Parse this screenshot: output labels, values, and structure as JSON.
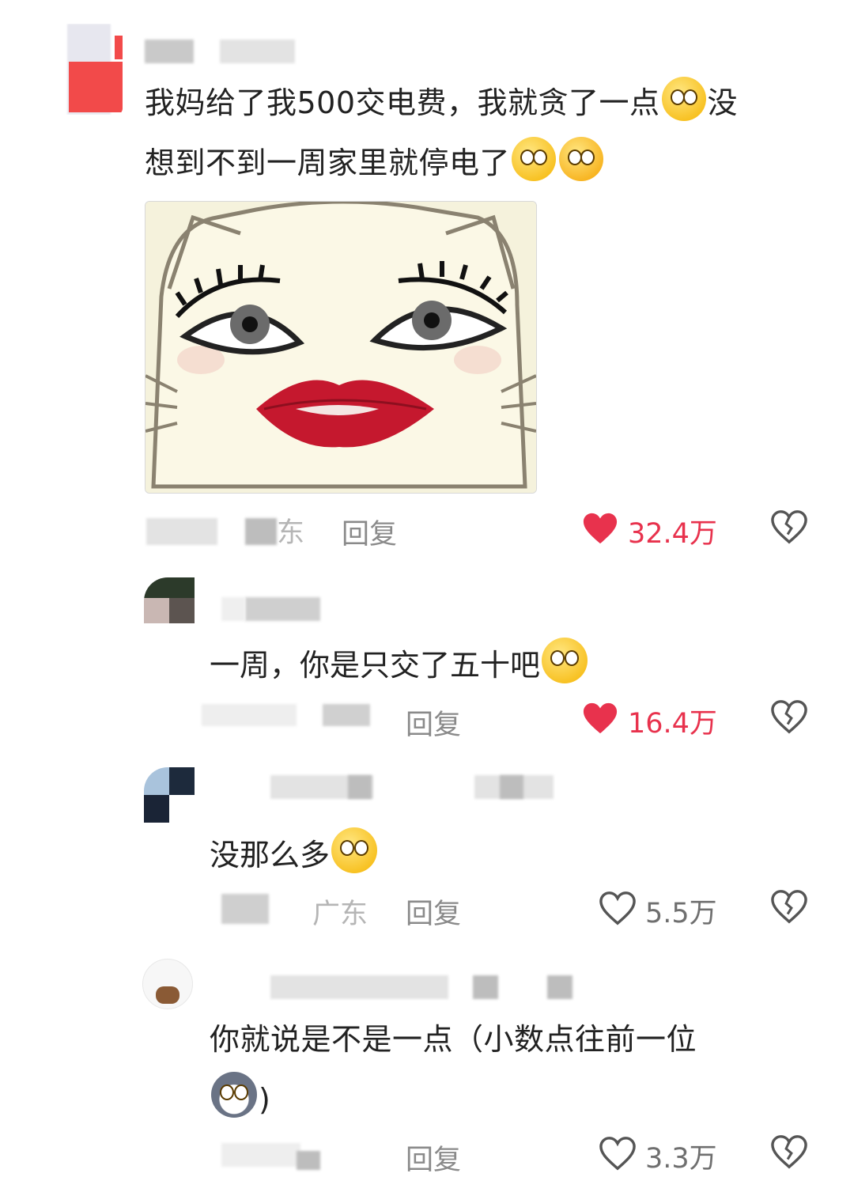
{
  "comments": [
    {
      "text_line1": "我妈给了我500交电费，我就贪了一点",
      "text_line1_end": "没",
      "text_line2": "想到不到一周家里就停电了",
      "meta_partial": "东",
      "reply_label": "回复",
      "likes": "32.4万",
      "liked": true
    },
    {
      "text": "一周，你是只交了五十吧",
      "reply_label": "回复",
      "likes": "16.4万",
      "liked": true
    },
    {
      "text": "没那么多",
      "meta_partial": "广东",
      "reply_label": "回复",
      "likes": "5.5万",
      "liked": false
    },
    {
      "text_line1": "你就说是不是一点（小数点往前一位",
      "text_line2": ")",
      "reply_label": "回复",
      "likes": "3.3万",
      "liked": false
    }
  ],
  "icons": {
    "like_filled": "heart-filled-icon",
    "like_outline": "heart-outline-icon",
    "dislike": "broken-heart-icon"
  },
  "colors": {
    "liked": "#e8324d",
    "meta": "#8a8a8a"
  }
}
